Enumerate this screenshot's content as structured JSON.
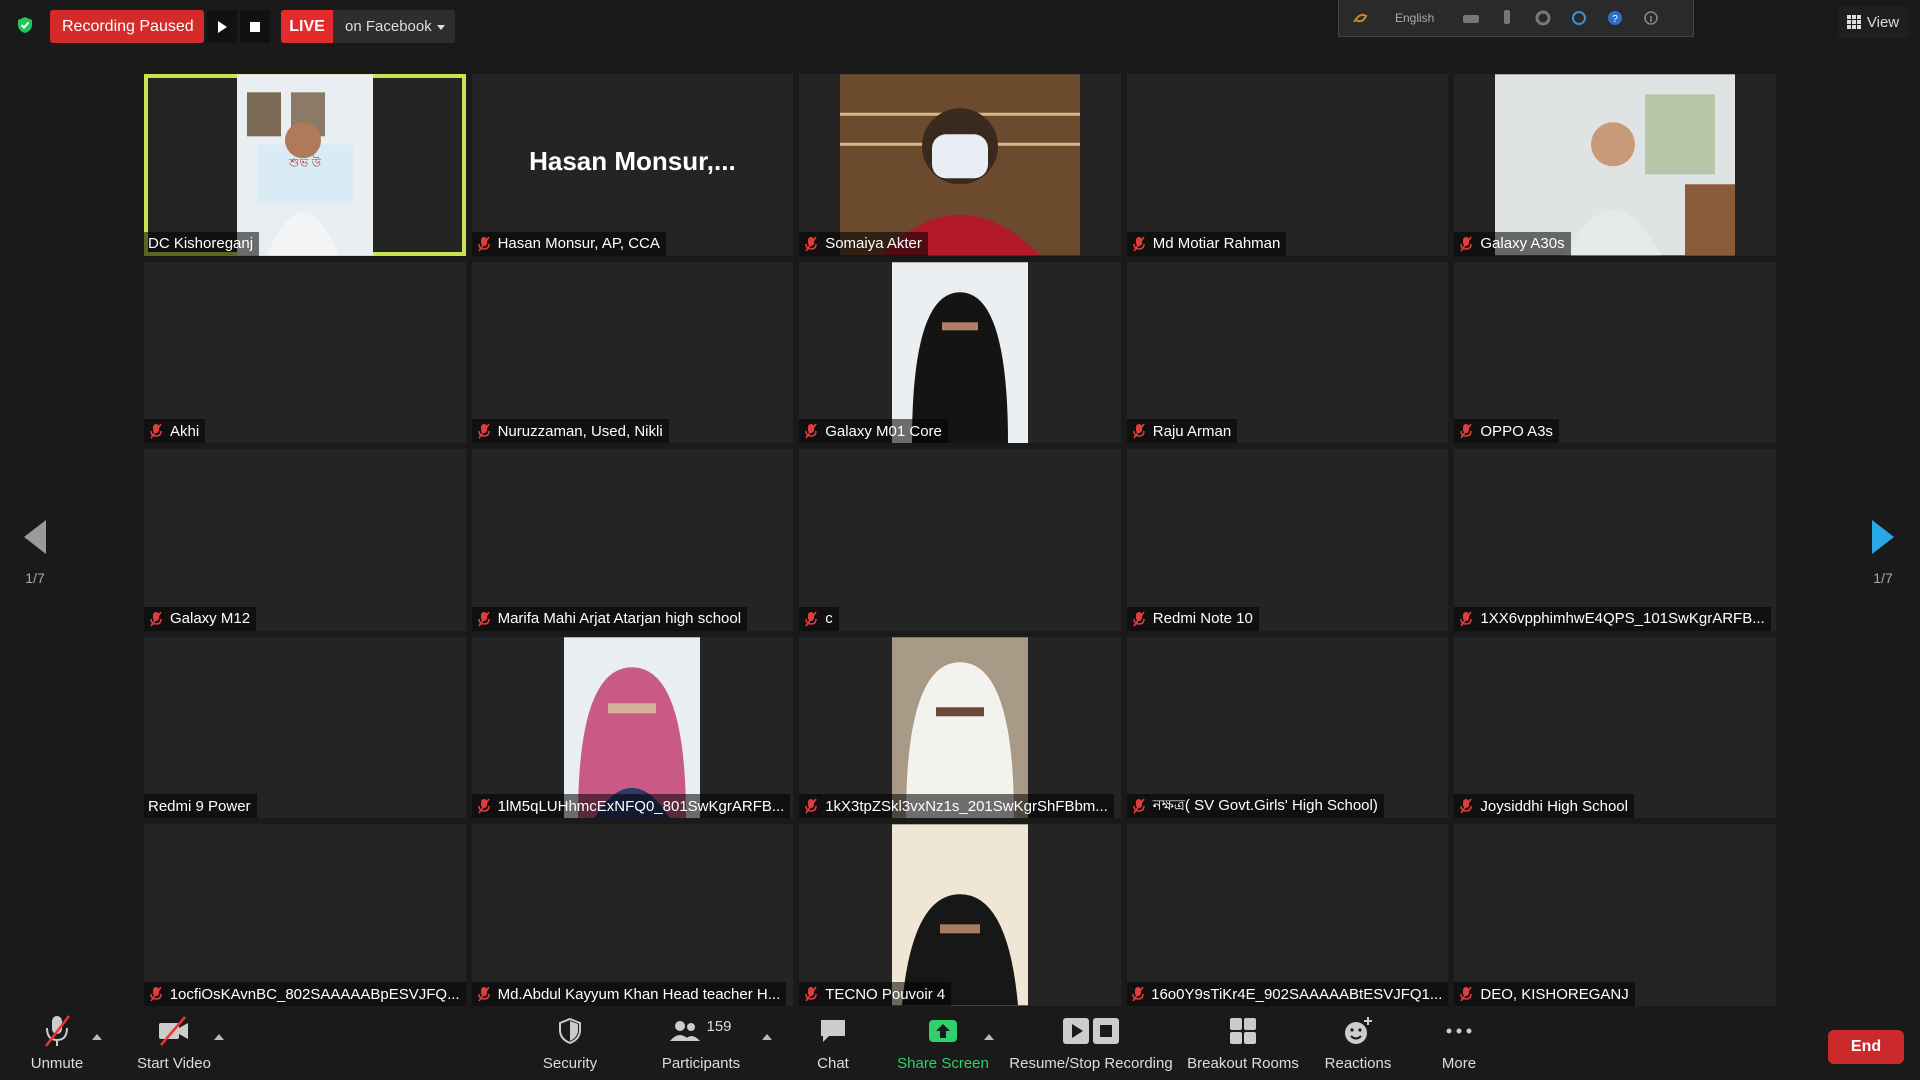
{
  "recording": {
    "status_label": "Recording Paused"
  },
  "live": {
    "badge": "LIVE",
    "destination": "on Facebook"
  },
  "ime": {
    "language": "English"
  },
  "view": {
    "label": "View"
  },
  "pagination": {
    "left": "1/7",
    "right": "1/7"
  },
  "featured_tile": {
    "big_name": "Hasan  Monsur,..."
  },
  "participants": [
    {
      "name": "DC Kishoreganj",
      "muted": false,
      "video": "dc",
      "active": true
    },
    {
      "name": "Hasan Monsur, AP, CCA",
      "muted": true,
      "video": "",
      "active": false
    },
    {
      "name": "Somaiya Akter",
      "muted": true,
      "video": "mask",
      "active": false
    },
    {
      "name": "Md Motiar Rahman",
      "muted": true,
      "video": "",
      "active": false
    },
    {
      "name": "Galaxy A30s",
      "muted": true,
      "video": "girl",
      "active": false
    },
    {
      "name": "Akhi",
      "muted": true,
      "video": "",
      "active": false
    },
    {
      "name": "Nuruzzaman, Used, Nikli",
      "muted": true,
      "video": "",
      "active": false
    },
    {
      "name": "Galaxy M01 Core",
      "muted": true,
      "video": "niqab-black",
      "active": false
    },
    {
      "name": "Raju Arman",
      "muted": true,
      "video": "",
      "active": false
    },
    {
      "name": "OPPO A3s",
      "muted": true,
      "video": "",
      "active": false
    },
    {
      "name": "Galaxy M12",
      "muted": true,
      "video": "",
      "active": false
    },
    {
      "name": "Marifa Mahi Arjat Atarjan high school",
      "muted": true,
      "video": "",
      "active": false
    },
    {
      "name": "c",
      "muted": true,
      "video": "",
      "active": false
    },
    {
      "name": "Redmi Note 10",
      "muted": true,
      "video": "",
      "active": false
    },
    {
      "name": "1XX6vpphimhwE4QPS_101SwKgrARFB...",
      "muted": true,
      "video": "",
      "active": false
    },
    {
      "name": "Redmi 9 Power",
      "muted": false,
      "video": "",
      "active": false
    },
    {
      "name": "1lM5qLUHhmcExNFQ0_801SwKgrARFB...",
      "muted": true,
      "video": "pink",
      "active": false
    },
    {
      "name": "1kX3tpZSkl3vxNz1s_201SwKgrShFBbm...",
      "muted": true,
      "video": "white",
      "active": false
    },
    {
      "name": "নক্ষত্র( SV Govt.Girls' High School)",
      "muted": true,
      "video": "",
      "active": false
    },
    {
      "name": "Joysiddhi High School",
      "muted": true,
      "video": "",
      "active": false
    },
    {
      "name": "1ocfiOsKAvnBC_802SAAAAABpESVJFQ...",
      "muted": true,
      "video": "",
      "active": false
    },
    {
      "name": "Md.Abdul Kayyum Khan Head teacher H...",
      "muted": true,
      "video": "",
      "active": false
    },
    {
      "name": "TECNO Pouvoir 4",
      "muted": true,
      "video": "niqab-black2",
      "active": false
    },
    {
      "name": "16o0Y9sTiKr4E_902SAAAAABtESVJFQ1...",
      "muted": true,
      "video": "",
      "active": false
    },
    {
      "name": "DEO, KISHOREGANJ",
      "muted": true,
      "video": "",
      "active": false
    }
  ],
  "toolbar": {
    "unmute": "Unmute",
    "start_video": "Start Video",
    "security": "Security",
    "participants": "Participants",
    "participants_count": "159",
    "chat": "Chat",
    "share_screen": "Share Screen",
    "resume_stop_recording": "Resume/Stop Recording",
    "breakout_rooms": "Breakout Rooms",
    "reactions": "Reactions",
    "more": "More",
    "end": "End"
  },
  "colors": {
    "active_border": "#c8e44f",
    "record_red": "#d42a2a",
    "share_green": "#2ed16b",
    "pager_blue": "#2aa7e6"
  }
}
